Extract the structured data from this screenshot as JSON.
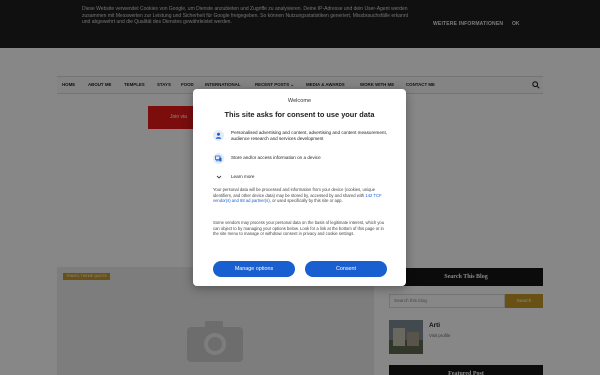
{
  "cookie_banner": {
    "text": "Diese Website verwendet Cookies von Google, um Dienste anzubieten und Zugriffe zu analysieren. Deine IP-Adresse und dein User-Agent werden zusammen mit Messwerten zur Leistung und Sicherheit für Google freigegeben. So können Nutzungsstatistiken generiert, Missbrauchsfälle erkannt und abgewehrt und die Qualität des Dienstes gewährleistet werden.",
    "more_label": "WEITERE INFORMATIONEN",
    "ok_label": "OK"
  },
  "nav": {
    "items": [
      "HOME",
      "ABOUT ME",
      "TEMPLES",
      "STAYS",
      "FOOD",
      "INTERNATIONAL",
      "RECENT POSTS ⌄",
      "MEDIA & AWARDS",
      "WORK WITH ME",
      "CONTACT ME"
    ],
    "search_icon": "search-icon"
  },
  "banner": {
    "text": "Join via"
  },
  "post": {
    "tag": "TRAVEL THEME QUOTE",
    "image_icon": "camera-icon"
  },
  "sidebar": {
    "search_title": "Search This Blog",
    "search_placeholder": "Search this blog",
    "search_button": "Search",
    "profile_name": "Arti",
    "profile_link": "Visit profile",
    "featured_title": "Featured Post"
  },
  "consent": {
    "welcome": "Welcome",
    "heading": "This site asks for consent to use your data",
    "purposes": [
      {
        "icon": "person-icon",
        "text": "Personalised advertising and content, advertising and content measurement, audience research and services development"
      },
      {
        "icon": "device-icon",
        "text": "Store and/or access information on a device"
      }
    ],
    "learn_more": "Learn more",
    "body1_a": "Your personal data will be processed and information from your device (cookies, unique identifiers, and other device data) may be stored by, accessed by and shared with ",
    "body1_link": "142 TCF vendor(s) and 68 ad partner(s)",
    "body1_b": ", or used specifically by this site or app.",
    "body2": "Some vendors may process your personal data on the basis of legitimate interest, which you can object to by managing your options below. Look for a link at the bottom of this page or in the site menu to manage or withdraw consent in privacy and cookie settings.",
    "manage_label": "Manage options",
    "consent_label": "Consent"
  },
  "colors": {
    "accent_blue": "#1a5fd0",
    "gold": "#c79a2a",
    "red": "#e81a1a"
  }
}
